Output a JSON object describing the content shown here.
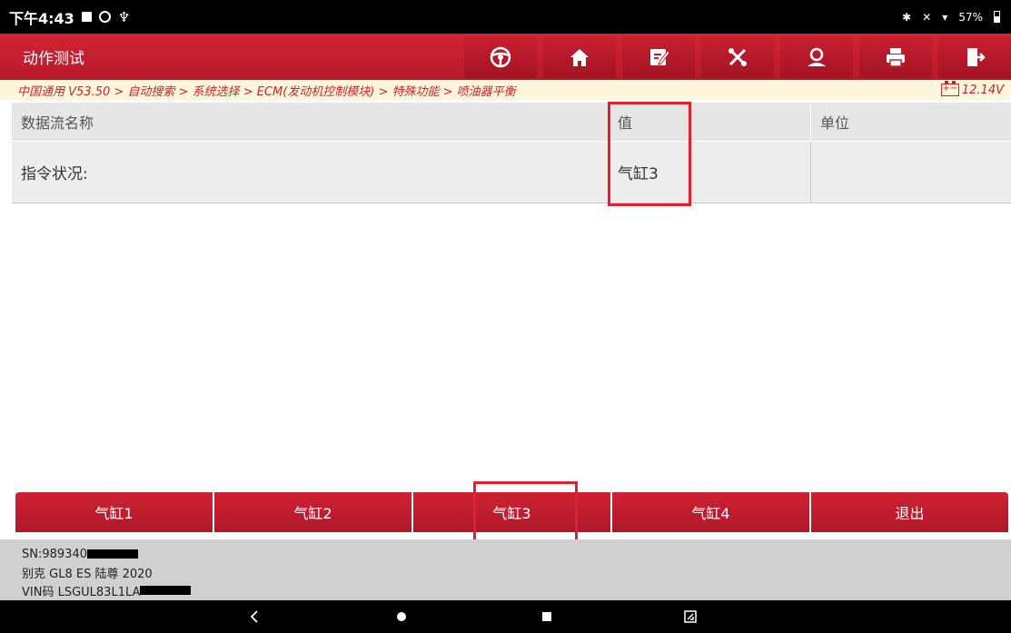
{
  "statusbar": {
    "time": "下午4:43",
    "battery": "57%"
  },
  "app": {
    "title": "动作测试"
  },
  "toolbar": {
    "icons": [
      "steering-wheel-icon",
      "home-icon",
      "report-icon",
      "tools-icon",
      "user-icon",
      "print-icon",
      "exit-icon"
    ]
  },
  "breadcrumb": {
    "path": "中国通用 V53.50 > 自动搜索 > 系统选择 > ECM(发动机控制模块) > 特殊功能 > 喷油器平衡",
    "voltage": "12.14V",
    "battery_symbol": "+−"
  },
  "table": {
    "headers": [
      "数据流名称",
      "值",
      "单位"
    ],
    "rows": [
      {
        "name": "指令状况:",
        "value": "气缸3",
        "unit": ""
      }
    ]
  },
  "functions": {
    "buttons": [
      "气缸1",
      "气缸2",
      "气缸3",
      "气缸4",
      "退出"
    ]
  },
  "device": {
    "sn": "SN:989340",
    "vehicle": "别克 GL8 ES 陆尊 2020",
    "vin": "VIN码 LSGUL83L1LA"
  },
  "colors": {
    "brand_red": "#c8202f",
    "highlight": "#e3202f",
    "breadcrumb_bg": "#fdf6da"
  }
}
